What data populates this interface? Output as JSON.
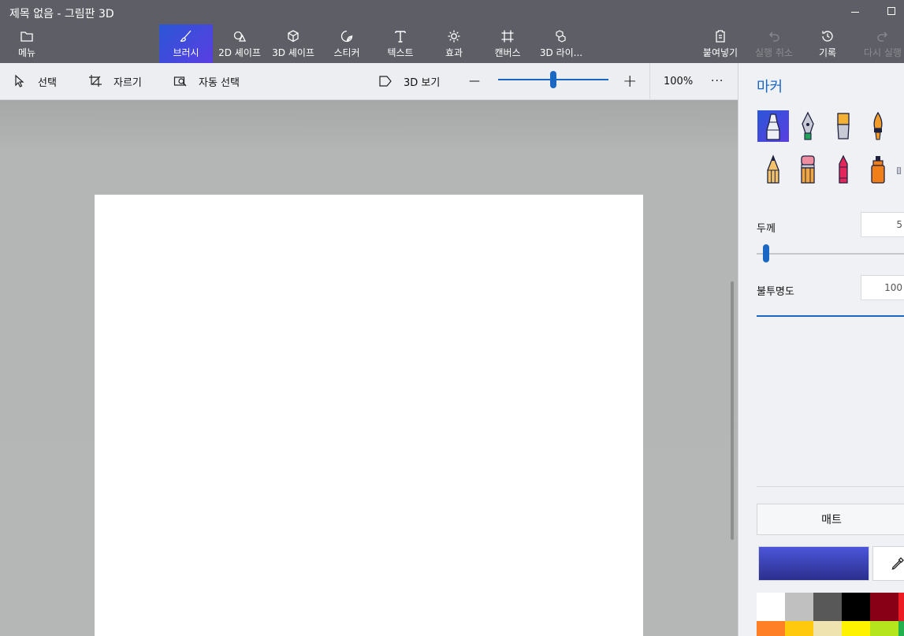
{
  "window": {
    "title": "제목 없음 - 그림판 3D"
  },
  "ribbon": {
    "menu_label": "메뉴",
    "brushes_label": "브러시",
    "shapes2d_label": "2D 셰이프",
    "shapes3d_label": "3D 셰이프",
    "stickers_label": "스티커",
    "text_label": "텍스트",
    "effects_label": "효과",
    "canvas_label": "캔버스",
    "library3d_label": "3D 라이...",
    "paste_label": "붙여넣기",
    "undo_label": "실행 취소",
    "history_label": "기록",
    "redo_label": "다시 실행"
  },
  "toolbar": {
    "select_label": "선택",
    "crop_label": "자르기",
    "magic_select_label": "자동 선택",
    "view3d_label": "3D 보기",
    "zoom_minus": "—",
    "zoom_plus": "+",
    "zoom_percent": "100%",
    "zoom_value": 0.5,
    "more": "···"
  },
  "panel": {
    "title": "마커",
    "brushes": [
      "marker",
      "calligraphy-pen",
      "oil-brush",
      "watercolor",
      "pencil",
      "eraser",
      "crayon",
      "spray-can",
      "pixel-pen"
    ],
    "selected_brush": "marker",
    "thickness_label": "두께",
    "thickness_value": "5",
    "opacity_label": "불투명도",
    "opacity_value": "100",
    "matte_label": "매트",
    "current_color": "#3f47cc",
    "palette_row1": [
      "#ffffff",
      "#c0c0c0",
      "#585858",
      "#000000",
      "#880015",
      "#ed1c24"
    ],
    "palette_row2": [
      "#ff7f27",
      "#ffc90e",
      "#efe4b0",
      "#fff200",
      "#b5e61d",
      "#22b14c"
    ]
  }
}
